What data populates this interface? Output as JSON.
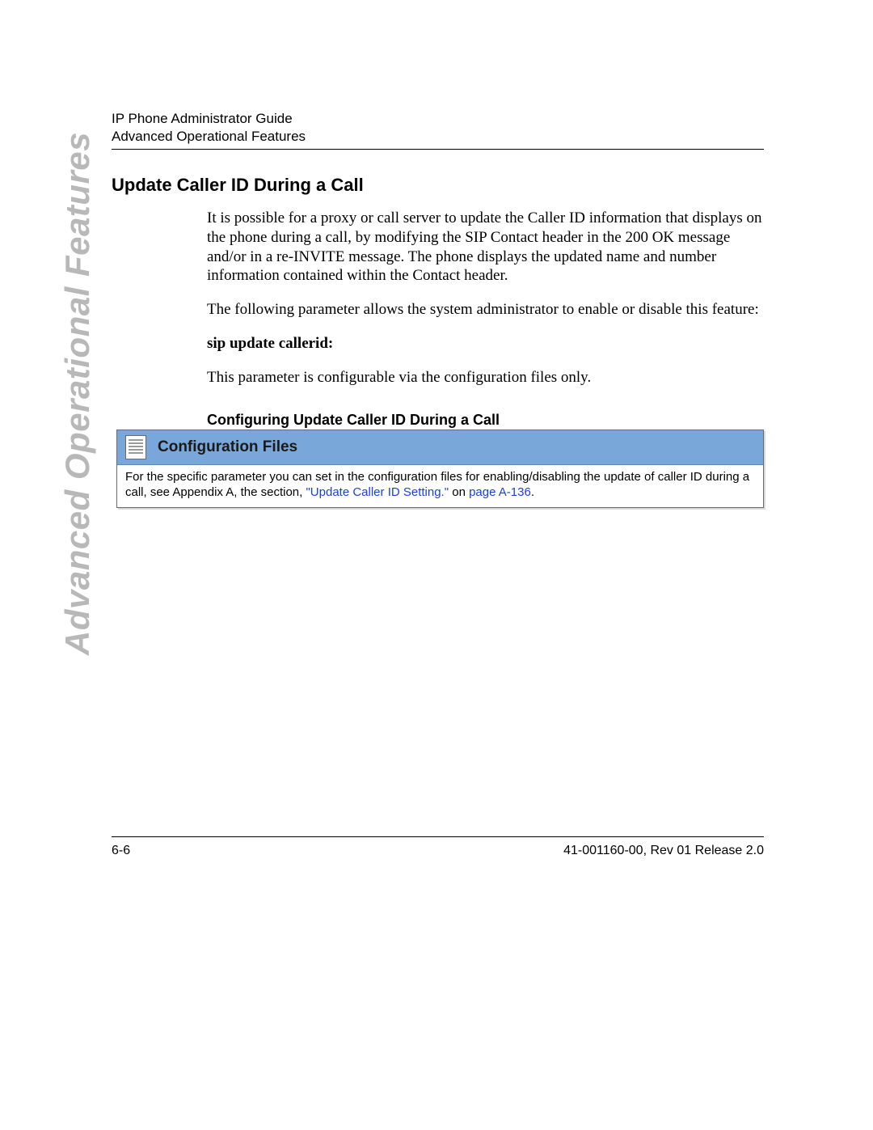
{
  "header": {
    "line1": "IP Phone Administrator Guide",
    "line2": "Advanced Operational Features"
  },
  "side_label": "Advanced Operational Features",
  "section": {
    "title": "Update Caller ID During a Call",
    "para1": "It is possible for a proxy or call server to update the Caller ID information that displays on the phone during a call, by modifying the SIP Contact header in the 200 OK message and/or in a re-INVITE message.  The phone displays the updated name and number information contained within the Contact header.",
    "para2": "The following parameter allows the system administrator to enable or disable this feature:",
    "param_name": "sip update callerid:",
    "para3": "This parameter is configurable via the configuration files only.",
    "subheading": "Configuring Update Caller ID During a Call"
  },
  "config_box": {
    "label": "Configuration Files",
    "note_pre": "For the specific parameter you can set in the configuration files for enabling/disabling the update of caller ID during a call, see Appendix A, the section, ",
    "note_link1": "\"Update Caller ID Setting.\"",
    "note_mid": " on ",
    "note_link2": "page A-136",
    "note_post": "."
  },
  "footer": {
    "left": "6-6",
    "right": "41-001160-00, Rev 01  Release 2.0"
  }
}
